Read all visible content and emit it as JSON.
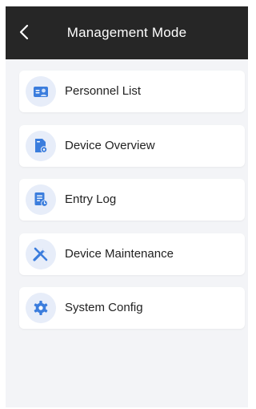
{
  "header": {
    "title": "Management Mode",
    "back_icon": "chevron-left-icon",
    "background": "#262626"
  },
  "menu": {
    "items": [
      {
        "label": "Personnel List",
        "icon": "personnel-card-icon"
      },
      {
        "label": "Device Overview",
        "icon": "device-gear-icon"
      },
      {
        "label": "Entry Log",
        "icon": "document-clock-icon"
      },
      {
        "label": "Device Maintenance",
        "icon": "wrench-screwdriver-icon"
      },
      {
        "label": "System Config",
        "icon": "gear-icon"
      }
    ]
  },
  "colors": {
    "accent_blue": "#3b7ddd",
    "icon_bg": "#e7edf9",
    "page_bg": "#f3f4f7"
  }
}
